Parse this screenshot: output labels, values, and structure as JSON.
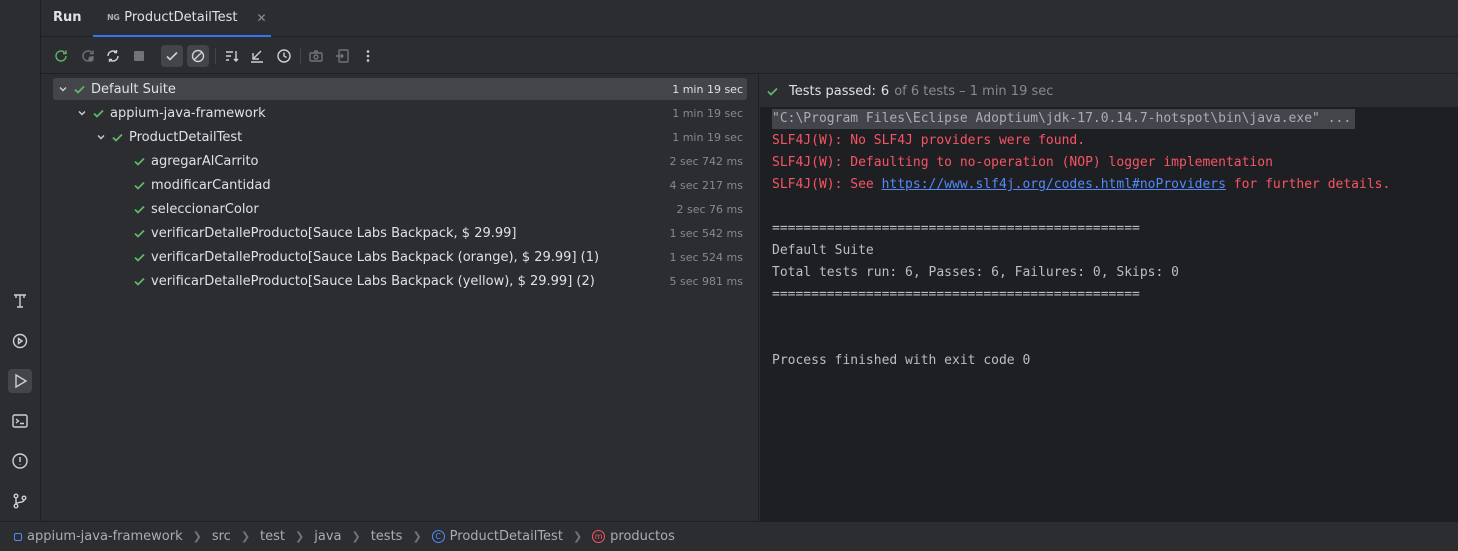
{
  "header": {
    "run_title": "Run",
    "tab": {
      "prefix": "NG",
      "label": "ProductDetailTest",
      "close": "✕"
    }
  },
  "toolbar": {
    "buttons": [
      "rerun-icon",
      "rerun-failed-icon",
      "toggle-auto-test-icon",
      "stop-icon",
      "show-passed-icon",
      "show-ignored-icon",
      "sort-alpha-icon",
      "collapse-icon",
      "history-icon",
      "screenshot-icon",
      "export-icon",
      "more-icon"
    ]
  },
  "tree": {
    "rows": [
      {
        "label": "Default Suite",
        "time": "1 min 19 sec",
        "level": 0,
        "expanded": true,
        "selected": true
      },
      {
        "label": "appium-java-framework",
        "time": "1 min 19 sec",
        "level": 1,
        "expanded": true
      },
      {
        "label": "ProductDetailTest",
        "time": "1 min 19 sec",
        "level": 2,
        "expanded": true
      },
      {
        "label": "agregarAlCarrito",
        "time": "2 sec 742 ms",
        "level": 3
      },
      {
        "label": "modificarCantidad",
        "time": "4 sec 217 ms",
        "level": 3
      },
      {
        "label": "seleccionarColor",
        "time": "2 sec 76 ms",
        "level": 3
      },
      {
        "label": "verificarDetalleProducto[Sauce Labs Backpack, $ 29.99]",
        "time": "1 sec 542 ms",
        "level": 3
      },
      {
        "label": "verificarDetalleProducto[Sauce Labs Backpack (orange), $ 29.99] (1)",
        "time": "1 sec 524 ms",
        "level": 3
      },
      {
        "label": "verificarDetalleProducto[Sauce Labs Backpack (yellow), $ 29.99] (2)",
        "time": "5 sec 981 ms",
        "level": 3
      }
    ]
  },
  "console": {
    "summary": {
      "passed_label": "Tests passed:",
      "count": "6",
      "rest": "of 6 tests – 1 min 19 sec"
    },
    "lines": [
      {
        "text": "\"C:\\Program Files\\Eclipse Adoptium\\jdk-17.0.14.7-hotspot\\bin\\java.exe\" ...",
        "kind": "cmd"
      },
      {
        "text": "SLF4J(W): No SLF4J providers were found.",
        "kind": "err"
      },
      {
        "text": "SLF4J(W): Defaulting to no-operation (NOP) logger implementation",
        "kind": "err"
      },
      {
        "text_before": "SLF4J(W): See ",
        "link": "https://www.slf4j.org/codes.html#noProviders",
        "text_after": " for further details.",
        "kind": "err-link"
      },
      {
        "text": "",
        "kind": "plain"
      },
      {
        "text": "===============================================",
        "kind": "plain"
      },
      {
        "text": "Default Suite",
        "kind": "plain"
      },
      {
        "text": "Total tests run: 6, Passes: 6, Failures: 0, Skips: 0",
        "kind": "plain"
      },
      {
        "text": "===============================================",
        "kind": "plain"
      },
      {
        "text": "",
        "kind": "plain"
      },
      {
        "text": "",
        "kind": "plain"
      },
      {
        "text": "Process finished with exit code 0",
        "kind": "plain"
      }
    ]
  },
  "statusbar": {
    "crumbs": [
      {
        "label": "appium-java-framework",
        "icon": "module-icon"
      },
      {
        "label": "src"
      },
      {
        "label": "test"
      },
      {
        "label": "java"
      },
      {
        "label": "tests"
      },
      {
        "label": "ProductDetailTest",
        "icon": "class-icon"
      },
      {
        "label": "productos",
        "icon": "method-icon"
      }
    ]
  },
  "colors": {
    "accent": "#3574f0",
    "pass_green": "#5fb865",
    "error_red": "#f75464",
    "link_blue": "#548af7"
  }
}
